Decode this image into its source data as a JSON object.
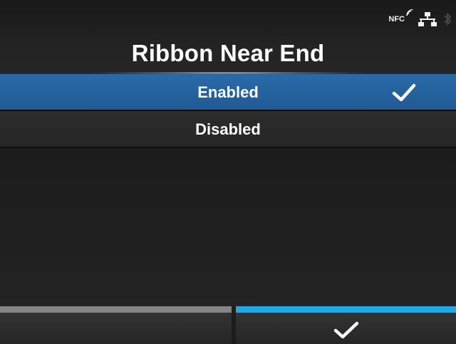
{
  "status": {
    "nfc_label": "NFC",
    "icons": [
      "nfc-icon",
      "network-icon",
      "bluetooth-icon"
    ]
  },
  "header": {
    "title": "Ribbon Near End"
  },
  "options": [
    {
      "label": "Enabled",
      "selected": true
    },
    {
      "label": "Disabled",
      "selected": false
    }
  ],
  "footer": {
    "left_button": "back",
    "right_button": "confirm-check-icon"
  },
  "colors": {
    "selected_bg": "#1f5a95",
    "confirm_accent": "#27a6e6",
    "back_accent": "#858585",
    "background": "#1c1c1c",
    "text": "#ffffff"
  }
}
